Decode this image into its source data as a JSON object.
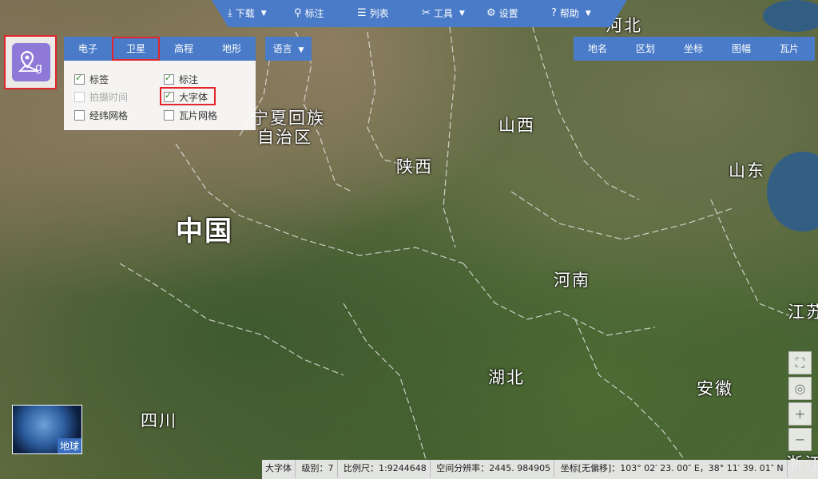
{
  "toolbar": {
    "download": "下载",
    "annotate": "标注",
    "list": "列表",
    "tools": "工具",
    "settings": "设置",
    "help": "帮助"
  },
  "layer_tabs": [
    "电子",
    "卫星",
    "高程",
    "地形"
  ],
  "active_layer": "卫星",
  "language": "语言",
  "options": {
    "label": "标签",
    "annotation": "标注",
    "capture_time": "拍摄时间",
    "big_font": "大字体",
    "graticule": "经纬网格",
    "tile_grid": "瓦片网格"
  },
  "right_tabs": [
    "地名",
    "区划",
    "坐标",
    "图幅",
    "瓦片"
  ],
  "regions": {
    "hebei": "河北",
    "ningxia_1": "宁夏回族",
    "ningxia_2": "自治区",
    "shanxi": "山西",
    "shandong": "山东",
    "shaanxi": "陕西",
    "china": "中国",
    "henan": "河南",
    "jiangsu": "江苏",
    "hubei": "湖北",
    "anhui": "安徽",
    "sichuan": "四川",
    "zhejiang": "浙江"
  },
  "globe_label": "地球",
  "status": {
    "mode": "大字体",
    "level": "级别：7",
    "scale": "比例尺：1:9244648",
    "resolution": "空间分辨率：2445. 984905",
    "coords": "坐标[无偏移]：103° 02′ 23. 00″ E，38° 11′ 39. 01″ N"
  },
  "colors": {
    "accent": "#4a7bc8",
    "highlight": "#e0262c",
    "app_icon": "#8e79d8"
  }
}
